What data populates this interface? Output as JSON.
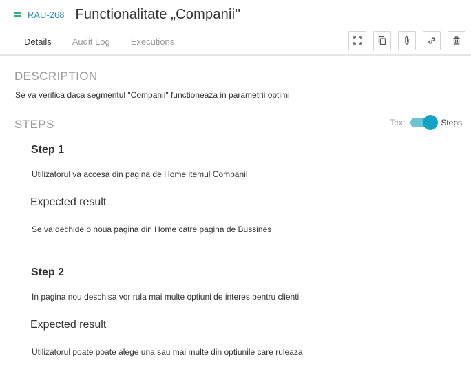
{
  "header": {
    "issue_key": "RAU-268",
    "title": "Functionalitate „Companii''"
  },
  "tabs": [
    {
      "label": "Details",
      "active": true
    },
    {
      "label": "Audit Log",
      "active": false
    },
    {
      "label": "Executions",
      "active": false
    }
  ],
  "toolbar": {
    "icons": [
      "expand-icon",
      "copy-icon",
      "attachment-icon",
      "link-icon",
      "trash-icon"
    ]
  },
  "description": {
    "label": "DESCRIPTION",
    "text": "Se va verifica daca segmentul \"Companii\" functioneaza in parametrii optimi"
  },
  "steps_section": {
    "label": "STEPS",
    "toggle": {
      "left_label": "Text",
      "right_label": "Steps",
      "selected": "Steps"
    },
    "steps": [
      {
        "title": "Step 1",
        "action": "Utilizatorul va accesa din pagina de Home itemul Companii",
        "expected_label": "Expected result",
        "expected": "Se va dechide o noua pagina din Home catre pagina de Bussines"
      },
      {
        "title": "Step 2",
        "action": "In pagina nou deschisa vor rula mai multe optiuni de interes pentru clienti",
        "expected_label": "Expected result",
        "expected": "Utilizatorul poate poate alege una sau mai multe din optiunile care ruleaza"
      }
    ]
  },
  "colors": {
    "accent_link": "#2a8fbf",
    "drag_handle": "#2fb57a",
    "toggle_knob": "#13a3c4",
    "toggle_track": "#6cc3d4"
  }
}
